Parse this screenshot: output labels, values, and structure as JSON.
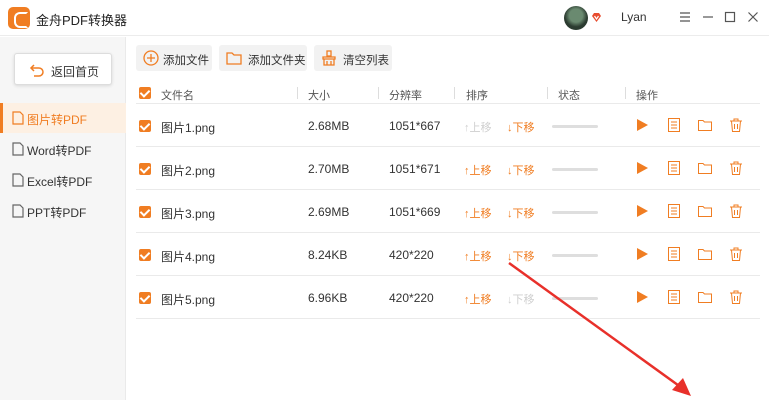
{
  "app": {
    "title": "金舟PDF转换器",
    "username": "Lyan",
    "accent": "#f07d22"
  },
  "window": {
    "menu_icon": "menu-icon",
    "minimize_icon": "minimize-icon",
    "maximize_icon": "maximize-icon",
    "close_icon": "close-icon"
  },
  "sidebar": {
    "home_label": "返回首页",
    "items": [
      {
        "label": "图片转PDF",
        "active": true
      },
      {
        "label": "Word转PDF",
        "active": false
      },
      {
        "label": "Excel转PDF",
        "active": false
      },
      {
        "label": "PPT转PDF",
        "active": false
      }
    ]
  },
  "toolbar": {
    "add_file": "添加文件",
    "add_folder": "添加文件夹",
    "clear_list": "清空列表"
  },
  "table": {
    "headers": {
      "name": "文件名",
      "size": "大小",
      "resolution": "分辨率",
      "sort": "排序",
      "status": "状态",
      "actions": "操作"
    },
    "move_up": "上移",
    "move_down": "下移",
    "rows": [
      {
        "name": "图片1.png",
        "size": "2.68MB",
        "resolution": "1051*667",
        "up_enabled": false,
        "down_enabled": true,
        "progress": 0
      },
      {
        "name": "图片2.png",
        "size": "2.70MB",
        "resolution": "1051*671",
        "up_enabled": true,
        "down_enabled": true,
        "progress": 0
      },
      {
        "name": "图片3.png",
        "size": "2.69MB",
        "resolution": "1051*669",
        "up_enabled": true,
        "down_enabled": true,
        "progress": 0
      },
      {
        "name": "图片4.png",
        "size": "8.24KB",
        "resolution": "420*220",
        "up_enabled": true,
        "down_enabled": true,
        "progress": 0
      },
      {
        "name": "图片5.png",
        "size": "6.96KB",
        "resolution": "420*220",
        "up_enabled": true,
        "down_enabled": false,
        "progress": 0
      }
    ]
  }
}
